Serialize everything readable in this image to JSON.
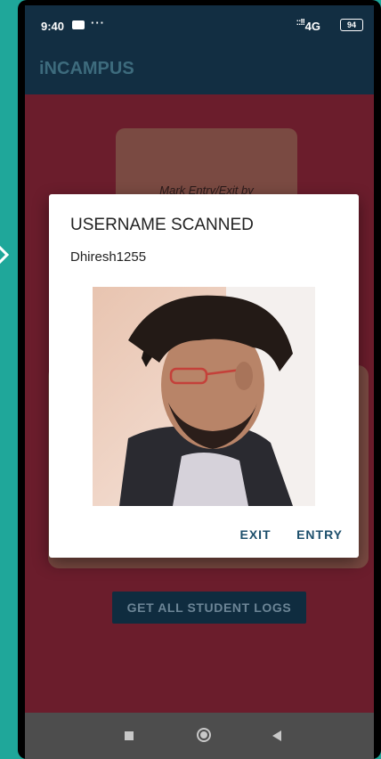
{
  "status_bar": {
    "time": "9:40",
    "dots": "···",
    "signal": "::!!",
    "network": "4G",
    "battery": "94"
  },
  "app_bar": {
    "title": "iNCAMPUS"
  },
  "background": {
    "card_text": "Mark Entry/Exit by"
  },
  "main": {
    "logs_button_label": "GET ALL STUDENT LOGS"
  },
  "dialog": {
    "title": "USERNAME SCANNED",
    "username": "Dhiresh1255",
    "actions": {
      "exit_label": "EXIT",
      "entry_label": "ENTRY"
    },
    "accent_color": "#1d4f6c"
  },
  "colors": {
    "app_bar": "#122e42",
    "page_background": "#6b1d2c",
    "outer_background": "#1fa79a"
  }
}
